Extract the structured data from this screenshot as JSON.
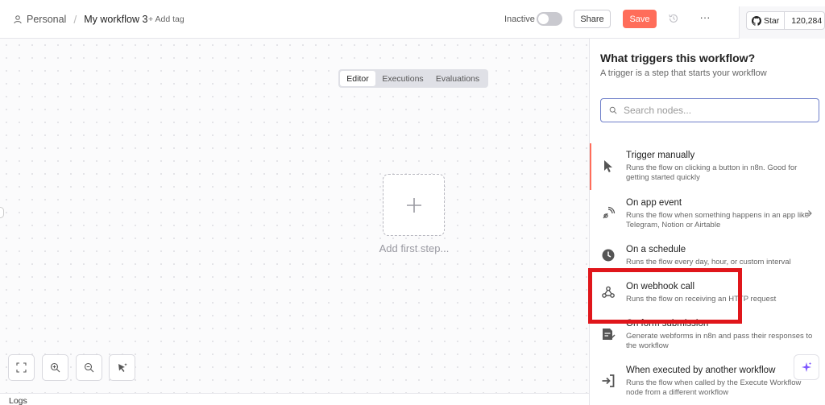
{
  "header": {
    "project": "Personal",
    "separator": "/",
    "workflow_name": "My workflow 3",
    "add_tag": "+ Add tag",
    "status_label": "Inactive",
    "share_label": "Share",
    "save_label": "Save",
    "more_label": "···",
    "github": {
      "star_label": "Star",
      "count": "120,284"
    }
  },
  "canvas": {
    "tabs": [
      {
        "label": "Editor",
        "active": true
      },
      {
        "label": "Executions",
        "active": false
      },
      {
        "label": "Evaluations",
        "active": false
      }
    ],
    "add_first_step": "Add first step...",
    "logs_label": "Logs"
  },
  "panel": {
    "title": "What triggers this workflow?",
    "subtitle": "A trigger is a step that starts your workflow",
    "search_placeholder": "Search nodes...",
    "nodes": [
      {
        "title": "Trigger manually",
        "desc": "Runs the flow on clicking a button in n8n. Good for getting started quickly",
        "icon": "cursor-icon"
      },
      {
        "title": "On app event",
        "desc": "Runs the flow when something happens in an app like Telegram, Notion or Airtable",
        "icon": "app-event-icon"
      },
      {
        "title": "On a schedule",
        "desc": "Runs the flow every day, hour, or custom interval",
        "icon": "clock-icon"
      },
      {
        "title": "On webhook call",
        "desc": "Runs the flow on receiving an HTTP request",
        "icon": "webhook-icon"
      },
      {
        "title": "On form submission",
        "desc": "Generate webforms in n8n and pass their responses to the workflow",
        "icon": "form-icon"
      },
      {
        "title": "When executed by another workflow",
        "desc": "Runs the flow when called by the Execute Workflow node from a different workflow",
        "icon": "sign-in-icon"
      }
    ]
  },
  "colors": {
    "accent": "#ff6d5a",
    "highlight_box": "#e0161b",
    "search_border": "#6d7ec9"
  }
}
